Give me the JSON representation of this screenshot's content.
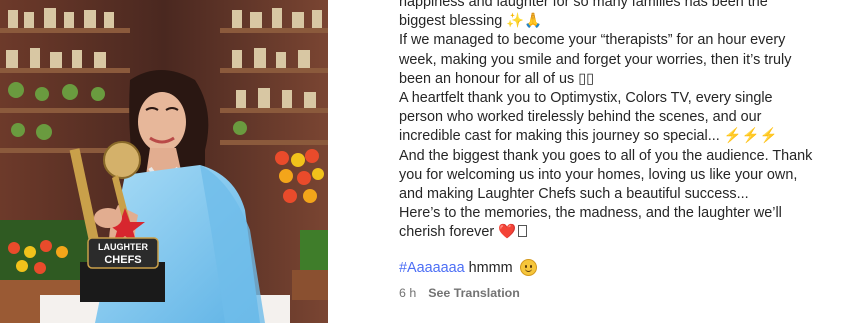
{
  "post": {
    "caption_lines": [
      "happiness and laughter for so many families has been the",
      "biggest blessing ✨🙏",
      "If we managed to become your “therapists” for an hour every",
      "week, making you smile and forget your worries, then it’s truly",
      "been an honour for all of us ▯▯",
      "A heartfelt thank you to Optimystix, Colors TV, every single",
      "person who worked tirelessly behind the scenes, and our",
      "incredible cast for making this journey so special... ⚡⚡⚡",
      "And the biggest thank you goes to all of you the audience. Thank",
      "you for welcoming us into your homes, loving us like your own,",
      "and making Laughter Chefs such a beautiful success...",
      "Here’s to the memories, the madness, and the laughter we’ll",
      "cherish forever"
    ],
    "cherish_heart": "❤️",
    "hashtag": "#Aaaaaaa",
    "hashtag_suffix": "hmmm",
    "time_ago": "6 h",
    "see_translation": "See Translation",
    "trophy_text_line1": "LAUGHTER",
    "trophy_text_line2": "CHEFS"
  },
  "colors": {
    "hashtag": "#4c6ef5",
    "text": "#262626",
    "meta": "#737373",
    "saree": "#7fc4ef"
  }
}
